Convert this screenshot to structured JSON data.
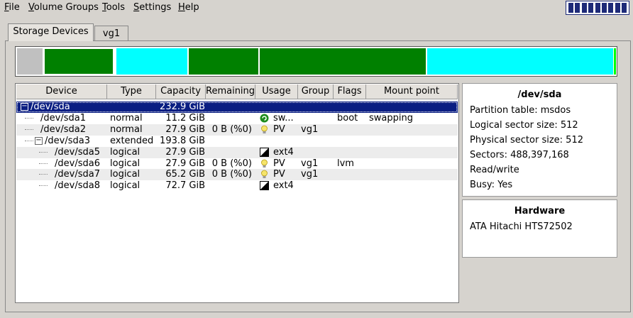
{
  "menu": {
    "items": [
      {
        "label": "File",
        "underline": "F"
      },
      {
        "label": "Volume Groups",
        "underline": "V"
      },
      {
        "label": "Tools",
        "underline": "T"
      },
      {
        "label": "Settings",
        "underline": "S"
      },
      {
        "label": "Help",
        "underline": "H"
      }
    ]
  },
  "tabs": [
    {
      "label": "Storage Devices",
      "active": true
    },
    {
      "label": "vg1",
      "active": false
    }
  ],
  "colors": {
    "selection": "#0a1e82",
    "ext4_partition": "#008000",
    "pv_partition": "#00ffff",
    "unallocated": "#c0c0c0"
  },
  "tree": {
    "columns": [
      "Device",
      "Type",
      "Capacity",
      "Remaining",
      "Usage",
      "Group",
      "Flags",
      "Mount point"
    ],
    "rows": [
      {
        "device": "/dev/sda",
        "type": "",
        "capacity": "232.9 GiB",
        "remaining": "",
        "usage": "",
        "usage_icon": "",
        "group": "",
        "flags": "",
        "mount": ""
      },
      {
        "device": "/dev/sda1",
        "type": "normal",
        "capacity": "11.2 GiB",
        "remaining": "",
        "usage": "sw...",
        "usage_icon": "swap-icon",
        "group": "",
        "flags": "boot",
        "mount": "swapping"
      },
      {
        "device": "/dev/sda2",
        "type": "normal",
        "capacity": "27.9 GiB",
        "remaining": "0 B (%0)",
        "usage": "PV",
        "usage_icon": "lightbulb-icon",
        "group": "vg1",
        "flags": "",
        "mount": ""
      },
      {
        "device": "/dev/sda3",
        "type": "extended",
        "capacity": "193.8 GiB",
        "remaining": "",
        "usage": "",
        "usage_icon": "",
        "group": "",
        "flags": "",
        "mount": ""
      },
      {
        "device": "/dev/sda5",
        "type": "logical",
        "capacity": "27.9 GiB",
        "remaining": "",
        "usage": "ext4",
        "usage_icon": "filesystem-icon",
        "group": "",
        "flags": "",
        "mount": ""
      },
      {
        "device": "/dev/sda6",
        "type": "logical",
        "capacity": "27.9 GiB",
        "remaining": "0 B (%0)",
        "usage": "PV",
        "usage_icon": "lightbulb-icon",
        "group": "vg1",
        "flags": "lvm",
        "mount": ""
      },
      {
        "device": "/dev/sda7",
        "type": "logical",
        "capacity": "65.2 GiB",
        "remaining": "0 B (%0)",
        "usage": "PV",
        "usage_icon": "lightbulb-icon",
        "group": "vg1",
        "flags": "",
        "mount": ""
      },
      {
        "device": "/dev/sda8",
        "type": "logical",
        "capacity": "72.7 GiB",
        "remaining": "",
        "usage": "ext4",
        "usage_icon": "filesystem-icon",
        "group": "",
        "flags": "",
        "mount": ""
      }
    ]
  },
  "info": {
    "title": "/dev/sda",
    "lines": [
      "Partition table: msdos",
      "Logical sector size: 512",
      "Physical sector size: 512",
      "Sectors: 488,397,168",
      "Read/write",
      "Busy: Yes"
    ]
  },
  "hardware": {
    "title": "Hardware",
    "model": "ATA Hitachi HTS72502"
  }
}
